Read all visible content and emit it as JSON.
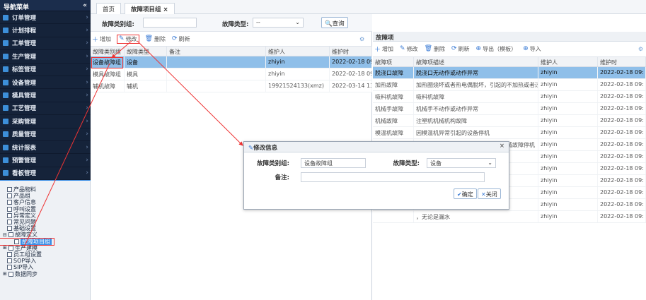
{
  "sidebar": {
    "title": "导航菜单",
    "collapse": "«",
    "items": [
      {
        "label": "订单管理"
      },
      {
        "label": "计划排程"
      },
      {
        "label": "工单管理"
      },
      {
        "label": "生产管理"
      },
      {
        "label": "标签管理"
      },
      {
        "label": "设备管理"
      },
      {
        "label": "模具管理"
      },
      {
        "label": "工艺管理"
      },
      {
        "label": "采购管理"
      },
      {
        "label": "质量管理"
      },
      {
        "label": "统计报表"
      },
      {
        "label": "预警管理"
      },
      {
        "label": "看板管理"
      },
      {
        "label": "基础数据"
      }
    ],
    "tree": [
      {
        "label": "产品物料"
      },
      {
        "label": "产品组"
      },
      {
        "label": "客户信息"
      },
      {
        "label": "呼叫设置"
      },
      {
        "label": "异常定义"
      },
      {
        "label": "常见问题"
      },
      {
        "label": "基础设置"
      },
      {
        "label": "故障定义"
      },
      {
        "label": "故障项目组"
      },
      {
        "label": "生产建模"
      },
      {
        "label": "员工组设置"
      },
      {
        "label": "SOP导入"
      },
      {
        "label": "SIP导入"
      },
      {
        "label": "数据同步"
      }
    ]
  },
  "tabs": {
    "home": "首页",
    "current": "故障项目组 ×"
  },
  "filter": {
    "group_label": "故障类别组:",
    "type_label": "故障类型:",
    "type_value": "--",
    "query": "查询"
  },
  "left_toolbar": {
    "add": "增加",
    "edit": "修改",
    "delete": "删除",
    "refresh": "刷新"
  },
  "left_grid": {
    "headers": [
      "故障类别组",
      "故障类型",
      "备注",
      "维护人",
      "维护时"
    ],
    "rows": [
      [
        "设备故障组",
        "设备",
        "",
        "zhiyin",
        "2022-02-18 09:"
      ],
      [
        "模具故障组",
        "模具",
        "",
        "zhiyin",
        "2022-02-18 09:"
      ],
      [
        "辅机故障",
        "辅机",
        "",
        "19921524133(xmz)",
        "2022-03-14 13:"
      ]
    ]
  },
  "right_panel": {
    "title": "故障项",
    "toolbar": {
      "add": "增加",
      "edit": "修改",
      "delete": "删除",
      "refresh": "刷新",
      "export": "导出（模板）",
      "import": "导入"
    },
    "headers": [
      "故障项",
      "故障项描述",
      "维护人",
      "维护时"
    ],
    "rows": [
      [
        "脱浇口故障",
        "脱浇口无动作或动作异常",
        "zhiyin",
        "2022-02-18 09:"
      ],
      [
        "加热故障",
        "加热圈烧坏或者热电偶脱坏，引起的不加热或者过",
        "zhiyin",
        "2022-02-18 09:"
      ],
      [
        "吸料机故障",
        "吸料机故障",
        "zhiyin",
        "2022-02-18 09:"
      ],
      [
        "机械手故障",
        "机械手不动作或动作异常",
        "zhiyin",
        "2022-02-18 09:"
      ],
      [
        "机械故障",
        "注塑机机械机构故障",
        "zhiyin",
        "2022-02-18 09:"
      ],
      [
        "模温机故障",
        "因模温机异常引起的设备停机",
        "zhiyin",
        "2022-02-18 09:"
      ],
      [
        "润滑故障",
        "停机加油或因润滑油压问题引起的机械故障停机",
        "zhiyin",
        "2022-02-18 09:"
      ],
      [
        "",
        "的设备异常",
        "zhiyin",
        "2022-02-18 09:"
      ],
      [
        "",
        "",
        "zhiyin",
        "2022-02-18 09:"
      ],
      [
        "",
        "备停机",
        "zhiyin",
        "2022-02-18 09:"
      ],
      [
        "",
        "连接处的电气",
        "zhiyin",
        "2022-02-18 09:"
      ],
      [
        "",
        "",
        "zhiyin",
        "2022-02-18 09:"
      ],
      [
        "",
        "，无论是漏水",
        "zhiyin",
        "2022-02-18 09:"
      ]
    ]
  },
  "modal": {
    "title": "修改信息",
    "close": "×",
    "group_label": "故障类别组:",
    "group_value": "设备故障组",
    "type_label": "故障类型:",
    "type_value": "设备",
    "remark_label": "备注:",
    "remark_value": "",
    "ok": "确定",
    "cancel": "关闭"
  },
  "colors": {
    "sidebar": "#15233a",
    "accent": "#3a8ee6",
    "highlight": "#e33"
  }
}
